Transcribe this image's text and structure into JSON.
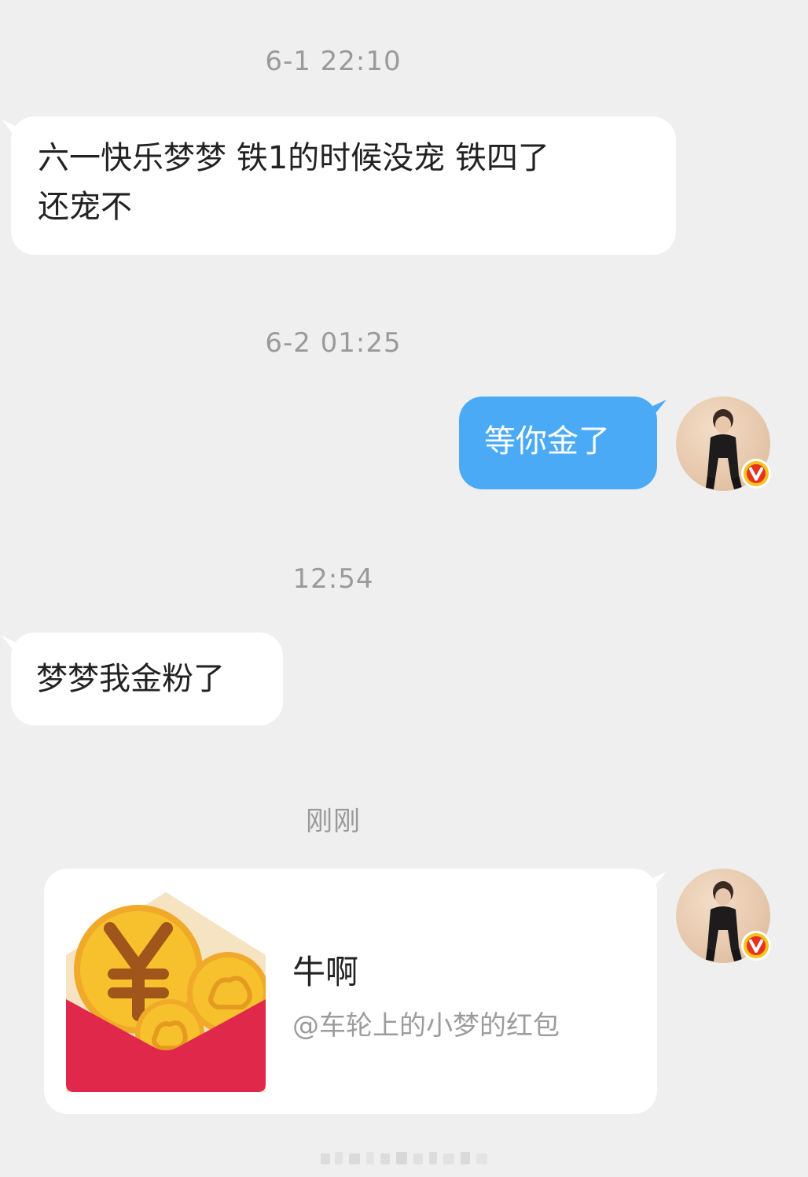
{
  "messages": [
    {
      "time": "6-1 22:10",
      "text": "六一快乐梦梦 铁1的时候没宠 铁四了还宠不",
      "line1": "六一快乐梦梦 铁1的时候没宠 铁四了",
      "line2": "还宠不"
    },
    {
      "time": "6-2 01:25",
      "text": "等你金了"
    },
    {
      "time": "12:54",
      "text": "梦梦我金粉了"
    },
    {
      "time": "刚刚"
    }
  ],
  "red_packet": {
    "title": "牛啊",
    "subtitle": "@车轮上的小梦的红包",
    "currency_symbol": "¥"
  },
  "avatar": {
    "badge": "v"
  },
  "colors": {
    "background": "#efefef",
    "outgoing_bubble": "#4aaaf5",
    "incoming_bubble": "#ffffff",
    "envelope_red": "#e0294a",
    "coin_gold": "#f6c12c",
    "badge_red": "#e8321e",
    "badge_yellow": "#f7c21e"
  }
}
